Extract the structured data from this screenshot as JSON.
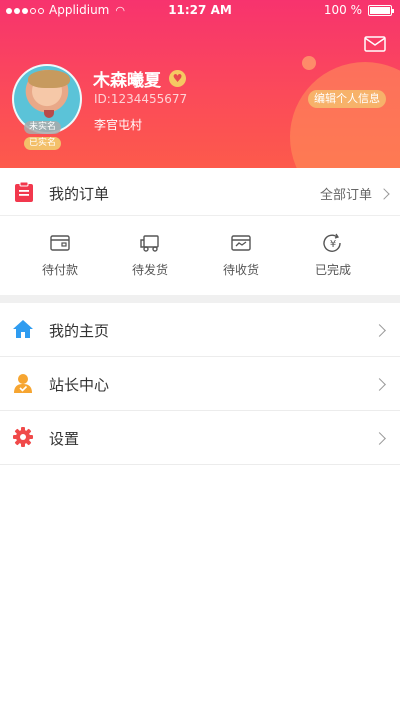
{
  "status_bar": {
    "carrier": "Applidium",
    "time": "11:27 AM",
    "battery": "100 %"
  },
  "profile": {
    "name": "木森曦夏",
    "id": "ID:1234455677",
    "village": "李官屯村",
    "badge_v": "未实名",
    "badge_real": "已实名",
    "edit_label": "编辑个人信息"
  },
  "orders": {
    "title": "我的订单",
    "all_label": "全部订单",
    "tabs": [
      {
        "label": "待付款",
        "icon": "wallet-icon"
      },
      {
        "label": "待发货",
        "icon": "truck-icon"
      },
      {
        "label": "待收货",
        "icon": "box-icon"
      },
      {
        "label": "已完成",
        "icon": "yuan-refresh-icon"
      }
    ]
  },
  "menu": [
    {
      "label": "我的主页",
      "icon": "home-icon",
      "color": "#2f9cf0"
    },
    {
      "label": "站长中心",
      "icon": "person-icon",
      "color": "#f6a531"
    },
    {
      "label": "设置",
      "icon": "gear-icon",
      "color": "#f04a4a"
    }
  ],
  "colors": {
    "header_top": "#f7336e",
    "header_bottom": "#fd5a4b",
    "accent_orange": "#f7b26a"
  }
}
